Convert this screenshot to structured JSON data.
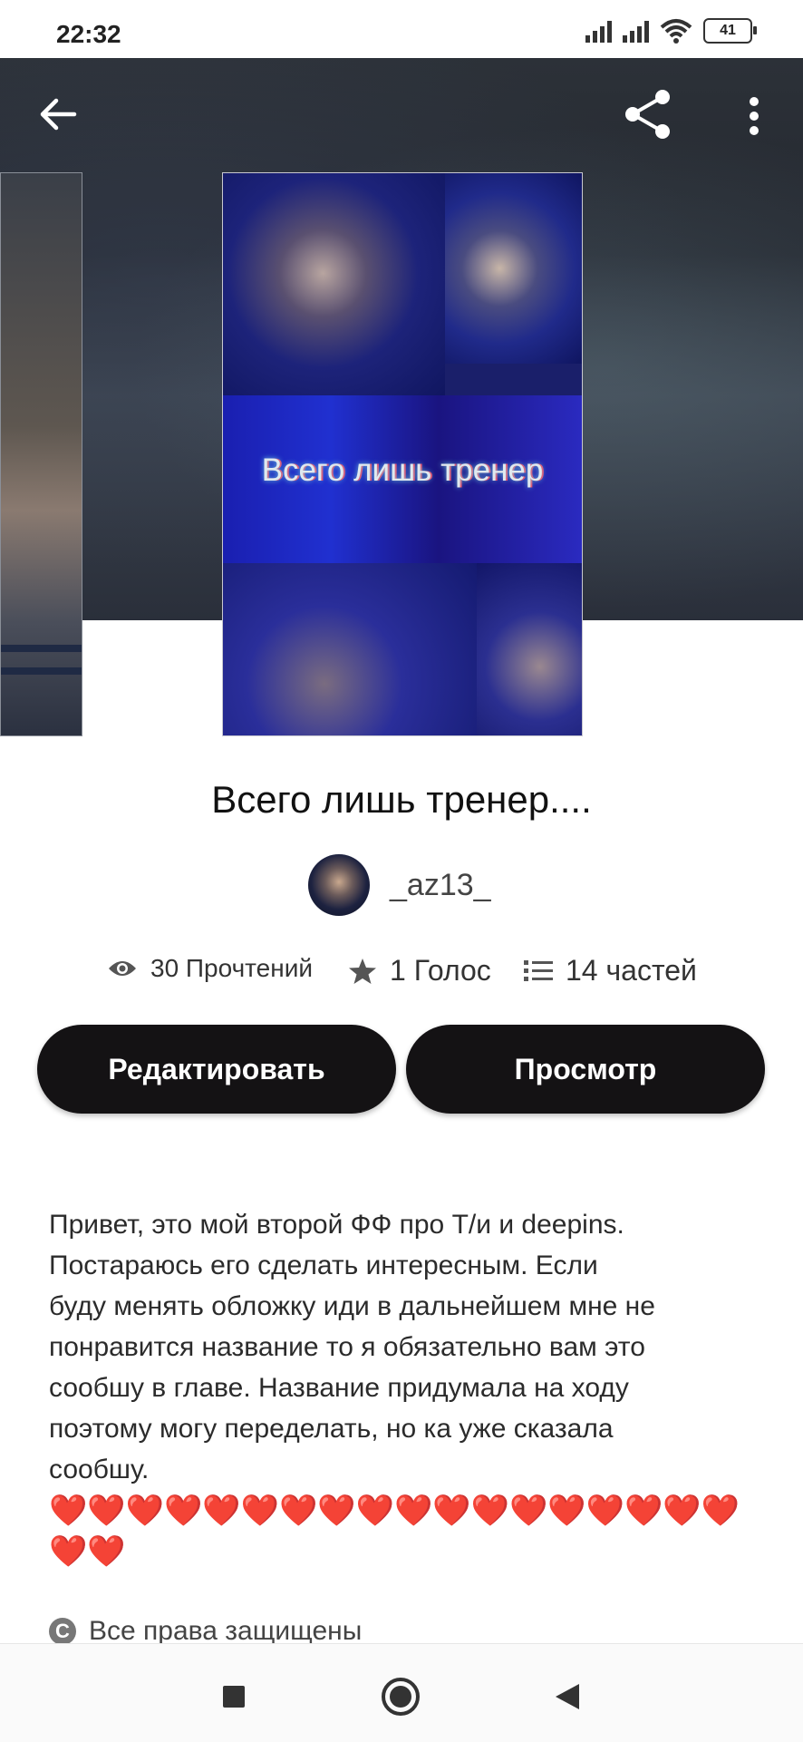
{
  "status_bar": {
    "time": "22:32",
    "battery": "41"
  },
  "header": {
    "back_icon": "arrow-left-icon",
    "share_icon": "share-icon",
    "more_icon": "more-vertical-icon"
  },
  "cover": {
    "title_overlay": "Всего лишь тренер"
  },
  "story": {
    "title": "Всего лишь тренер....",
    "author": "_az13_"
  },
  "stats": {
    "reads": "30 Прочтений",
    "votes": "1 Голос",
    "parts": "14 частей"
  },
  "actions": {
    "edit_label": "Редактировать",
    "view_label": "Просмотр"
  },
  "description": "Привет, это мой второй ФФ про Т/и и deepins.\nПостараюсь его сделать интересным. Если\nбуду менять обложку иди в дальнейшем мне не\nпонравится название то я обязательно вам это\nсообшу в главе. Название придумала на ходу\nпоэтому могу переделать, но ка уже сказала\nсообшу.",
  "hearts": "❤️❤️❤️❤️❤️❤️❤️❤️❤️❤️❤️❤️❤️❤️❤️❤️❤️❤️❤️❤️",
  "copyright": "Все права защищены",
  "colors": {
    "button_bg": "#141214",
    "accent_text": "#111111"
  }
}
